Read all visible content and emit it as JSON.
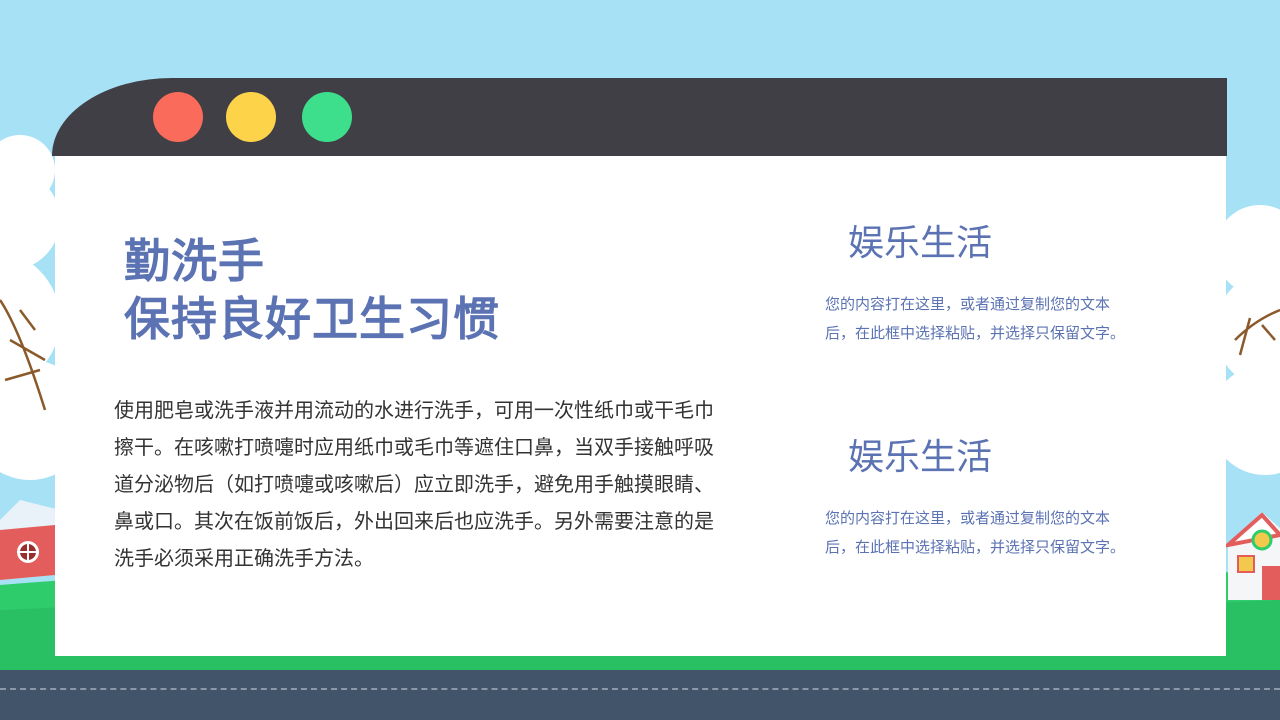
{
  "colors": {
    "sky": "#a7e1f6",
    "grass": "#2fcc6b",
    "road": "#42546a",
    "window_bar": "#403f45",
    "window_body": "#ffffff",
    "accent": "#5b72b3",
    "dot_red": "#fa6b5b",
    "dot_yellow": "#fdd34a",
    "dot_green": "#3ddf8c"
  },
  "window": {
    "buttons": [
      "close-dot",
      "minimize-dot",
      "maximize-dot"
    ]
  },
  "main": {
    "title_line1": "勤洗手",
    "title_line2": "保持良好卫生习惯",
    "body": "使用肥皂或洗手液并用流动的水进行洗手，可用一次性纸巾或干毛巾擦干。在咳嗽打喷嚏时应用纸巾或毛巾等遮住口鼻，当双手接触呼吸道分泌物后（如打喷嚏或咳嗽后）应立即洗手，避免用手触摸眼睛、鼻或口。其次在饭前饭后，外出回来后也应洗手。另外需要注意的是洗手必须采用正确洗手方法。"
  },
  "sections": [
    {
      "heading": "娱乐生活",
      "text": "您的内容打在这里，或者通过复制您的文本后，在此框中选择粘贴，并选择只保留文字。"
    },
    {
      "heading": "娱乐生活",
      "text": "您的内容打在这里，或者通过复制您的文本后，在此框中选择粘贴，并选择只保留文字。"
    }
  ]
}
